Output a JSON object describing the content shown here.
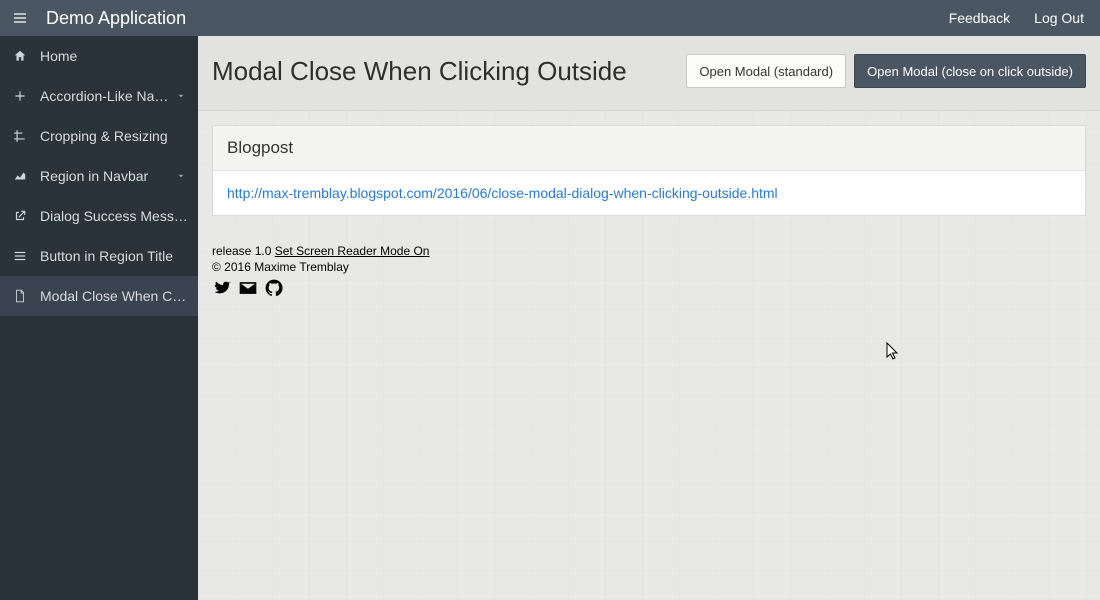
{
  "header": {
    "app_title": "Demo Application",
    "links": {
      "feedback": "Feedback",
      "logout": "Log Out"
    }
  },
  "sidebar": {
    "items": [
      {
        "icon": "home",
        "label": "Home",
        "expandable": false,
        "active": false
      },
      {
        "icon": "plus",
        "label": "Accordion-Like Navi...",
        "expandable": true,
        "active": false
      },
      {
        "icon": "crop",
        "label": "Cropping & Resizing",
        "expandable": false,
        "active": false
      },
      {
        "icon": "chart",
        "label": "Region in Navbar",
        "expandable": true,
        "active": false
      },
      {
        "icon": "external",
        "label": "Dialog Success Message",
        "expandable": false,
        "active": false
      },
      {
        "icon": "list",
        "label": "Button in Region Title",
        "expandable": false,
        "active": false
      },
      {
        "icon": "file",
        "label": "Modal Close When Click...",
        "expandable": false,
        "active": true
      }
    ]
  },
  "main": {
    "title": "Modal Close When Clicking Outside",
    "buttons": {
      "standard": "Open Modal (standard)",
      "outside": "Open Modal (close on click outside)"
    },
    "region": {
      "title": "Blogpost",
      "link_text": "http://max-tremblay.blogspot.com/2016/06/close-modal-dialog-when-clicking-outside.html"
    }
  },
  "footer": {
    "release": "release 1.0",
    "screen_reader": "Set Screen Reader Mode On",
    "copyright": "© 2016 Maxime Tremblay"
  }
}
